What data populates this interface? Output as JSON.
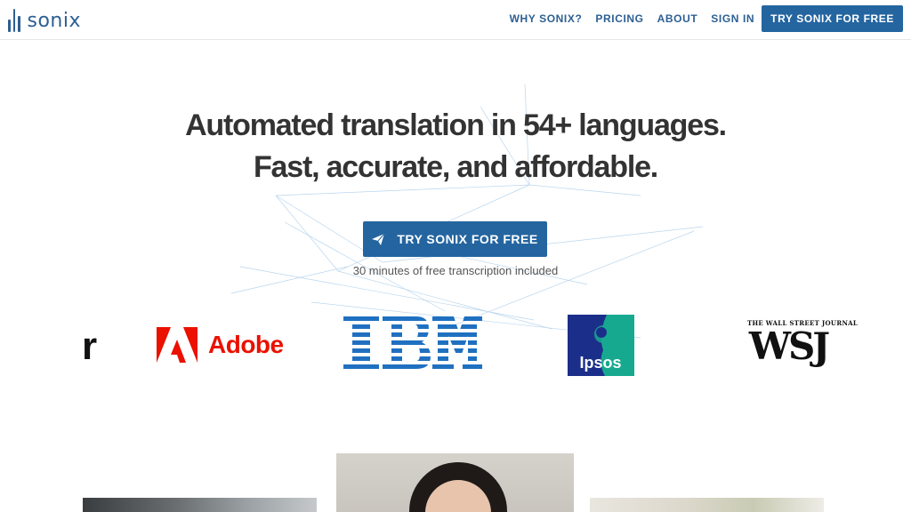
{
  "header": {
    "logo_text": "sonix",
    "nav": [
      {
        "label": "WHY SONIX?"
      },
      {
        "label": "PRICING"
      },
      {
        "label": "ABOUT"
      },
      {
        "label": "SIGN IN"
      }
    ],
    "cta_label": "TRY SONIX FOR FREE"
  },
  "hero": {
    "title_line1": "Automated translation in 54+ languages.",
    "title_line2": "Fast, accurate, and affordable.",
    "cta_label": "TRY SONIX FOR FREE",
    "cta_icon": "paper-plane-icon",
    "subtext": "30 minutes of free transcription included"
  },
  "logos": {
    "partial_letter": "r",
    "adobe": "Adobe",
    "ibm": "IBM",
    "ipsos": "Ipsos",
    "wsj_top": "THE WALL STREET JOURNAL",
    "wsj": "WSJ"
  },
  "colors": {
    "brand": "#2465a0",
    "text": "#333333",
    "adobe_red": "#eb1000",
    "ibm_blue": "#1f70c1",
    "ipsos_navy": "#1b2f8a",
    "ipsos_teal": "#17a98f"
  }
}
